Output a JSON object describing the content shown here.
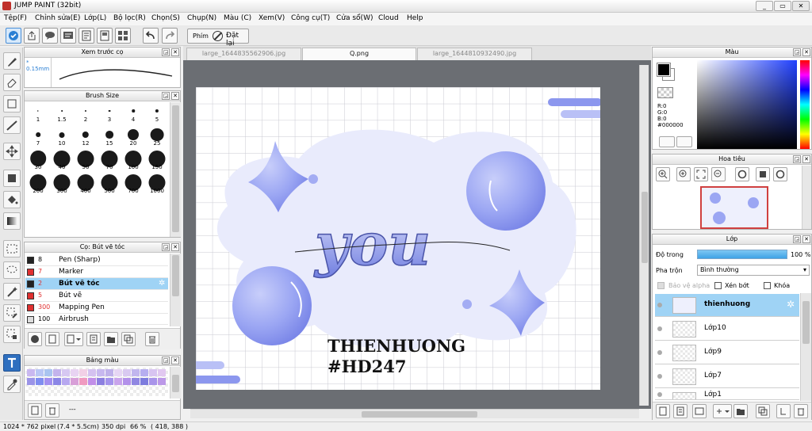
{
  "window": {
    "title": "JUMP PAINT (32bit)"
  },
  "menu": [
    "Tệp(F)",
    "Chỉnh sửa(E)",
    "Lớp(L)",
    "Bộ lọc(R)",
    "Chọn(S)",
    "Chụp(N)",
    "Màu (C)",
    "Xem(V)",
    "Công cụ(T)",
    "Cửa sổ(W)",
    "Cloud",
    "Help"
  ],
  "toolbar": {
    "key_label": "Phím",
    "reset_label": "Đặt lại"
  },
  "brush_preview": {
    "title": "Xem trước cọ",
    "size_text": "* 0.15mm"
  },
  "brush_size": {
    "title": "Brush Size",
    "sizes": [
      "1",
      "1.5",
      "2",
      "3",
      "4",
      "5",
      "7",
      "10",
      "12",
      "15",
      "20",
      "25",
      "30",
      "40",
      "50",
      "70",
      "100",
      "150",
      "200",
      "300",
      "400",
      "500",
      "700",
      "1000"
    ]
  },
  "brush_list": {
    "title": "Cọ: Bút vẽ tóc",
    "items": [
      {
        "size": "8",
        "name": "Pen (Sharp)",
        "color": "#222222"
      },
      {
        "size": "7",
        "name": "Marker",
        "color": "#e03030"
      },
      {
        "size": "2",
        "name": "Bút vẽ tóc",
        "color": "#e03030"
      },
      {
        "size": "5",
        "name": "Bút vẽ",
        "color": "#e03030"
      },
      {
        "size": "300",
        "name": "Mapping Pen",
        "color": "#e03030"
      },
      {
        "size": "100",
        "name": "Airbrush",
        "color": "#dddddd"
      }
    ]
  },
  "palette": {
    "title": "Bảng màu",
    "footer_text": "---"
  },
  "tabs": [
    "large_1644835562906.jpg",
    "Q.png",
    "large_1644810932490.jpg"
  ],
  "artwork": {
    "word": "you",
    "line1": "THIENHUONG",
    "line2": "#HD247"
  },
  "color_panel": {
    "title": "Màu",
    "r": "R:0",
    "g": "G:0",
    "b": "B:0",
    "hex": "#000000"
  },
  "navigator": {
    "title": "Hoa tiêu"
  },
  "layers": {
    "title": "Lớp",
    "opacity_label": "Độ trong",
    "opacity_value": "100 %",
    "blend_label": "Pha trộn",
    "blend_value": "Bình thường",
    "protect_alpha": "Bảo vệ alpha",
    "clip_label": "Xén bớt",
    "lock_label": "Khóa",
    "items": [
      {
        "name": "thienhuong"
      },
      {
        "name": "Lớp10"
      },
      {
        "name": "Lớp9"
      },
      {
        "name": "Lớp7"
      },
      {
        "name": "Lớp1"
      }
    ]
  },
  "status": {
    "size": "1024 * 762 pixel",
    "cm": "(7.4 * 5.5cm)",
    "dpi": "350 dpi",
    "zoom": "66 %",
    "coords": "( 418, 388 )"
  },
  "colors": {
    "accent": "#9fd3f5",
    "art_blue": "#7f8df0"
  }
}
